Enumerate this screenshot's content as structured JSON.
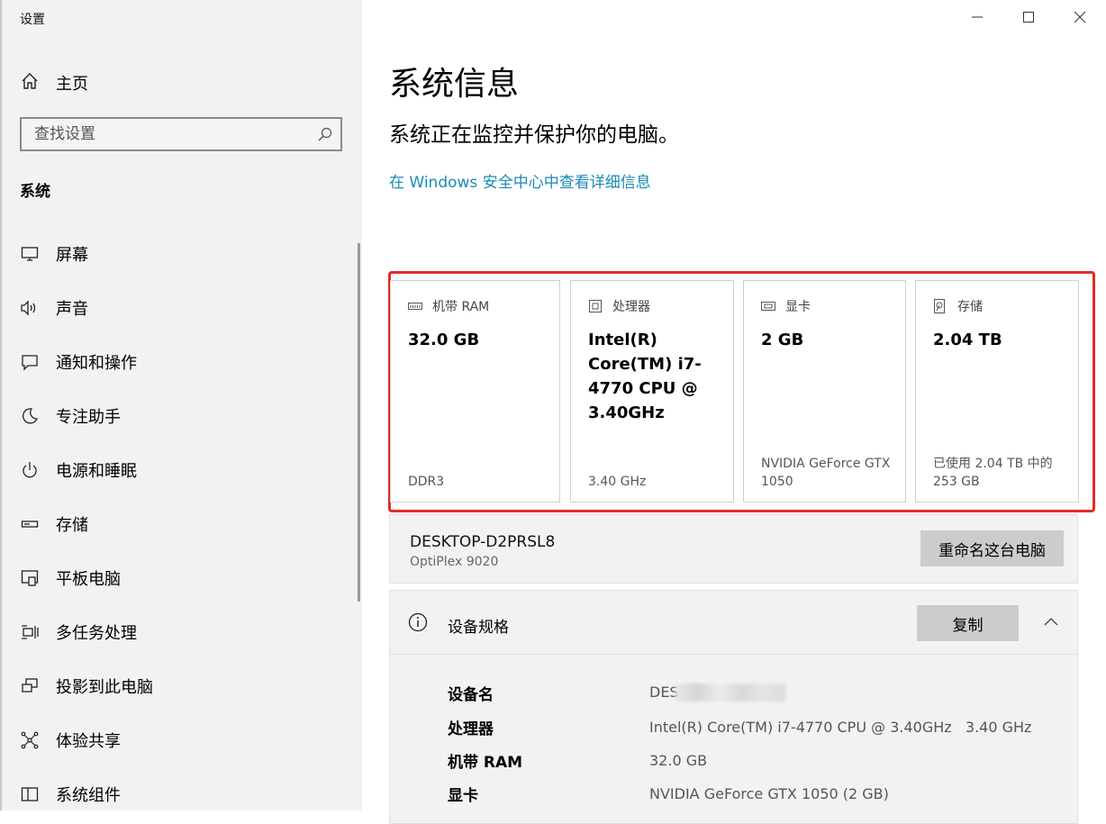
{
  "window": {
    "title": "设置"
  },
  "sidebar": {
    "home_label": "主页",
    "search_placeholder": "查找设置",
    "section_title": "系统",
    "items": [
      {
        "label": "屏幕",
        "icon": "monitor-icon"
      },
      {
        "label": "声音",
        "icon": "speaker-icon"
      },
      {
        "label": "通知和操作",
        "icon": "notification-icon"
      },
      {
        "label": "专注助手",
        "icon": "moon-icon"
      },
      {
        "label": "电源和睡眠",
        "icon": "power-icon"
      },
      {
        "label": "存储",
        "icon": "storage-icon"
      },
      {
        "label": "平板电脑",
        "icon": "tablet-icon"
      },
      {
        "label": "多任务处理",
        "icon": "multitask-icon"
      },
      {
        "label": "投影到此电脑",
        "icon": "project-icon"
      },
      {
        "label": "体验共享",
        "icon": "share-icon"
      },
      {
        "label": "系统组件",
        "icon": "components-icon"
      }
    ]
  },
  "main": {
    "title": "系统信息",
    "subtitle": "系统正在监控并保护你的电脑。",
    "link": "在 Windows 安全中心中查看详细信息",
    "cards": [
      {
        "label": "机带 RAM",
        "value": "32.0 GB",
        "footer": "DDR3",
        "icon": "ram-icon"
      },
      {
        "label": "处理器",
        "value": "Intel(R) Core(TM) i7-4770 CPU @ 3.40GHz",
        "footer": "3.40 GHz",
        "icon": "cpu-icon"
      },
      {
        "label": "显卡",
        "value": "2 GB",
        "footer": "NVIDIA GeForce GTX 1050",
        "icon": "gpu-icon"
      },
      {
        "label": "存储",
        "value": "2.04 TB",
        "footer": "已使用 2.04 TB 中的 253 GB",
        "icon": "disk-icon"
      }
    ],
    "pc": {
      "name": "DESKTOP-D2PRSL8",
      "model": "OptiPlex 9020",
      "rename_label": "重命名这台电脑"
    },
    "specs": {
      "title": "设备规格",
      "copy_label": "复制",
      "rows": [
        {
          "key": "设备名",
          "value": "DES"
        },
        {
          "key": "处理器",
          "value": "Intel(R) Core(TM) i7-4770 CPU @ 3.40GHz   3.40 GHz"
        },
        {
          "key": "机带 RAM",
          "value": "32.0 GB"
        },
        {
          "key": "显卡",
          "value": "NVIDIA GeForce GTX 1050 (2 GB)"
        }
      ]
    }
  },
  "colors": {
    "link": "#1a8ab5",
    "highlight": "#e02b2b",
    "sidebar_bg": "#f2f2f2"
  }
}
